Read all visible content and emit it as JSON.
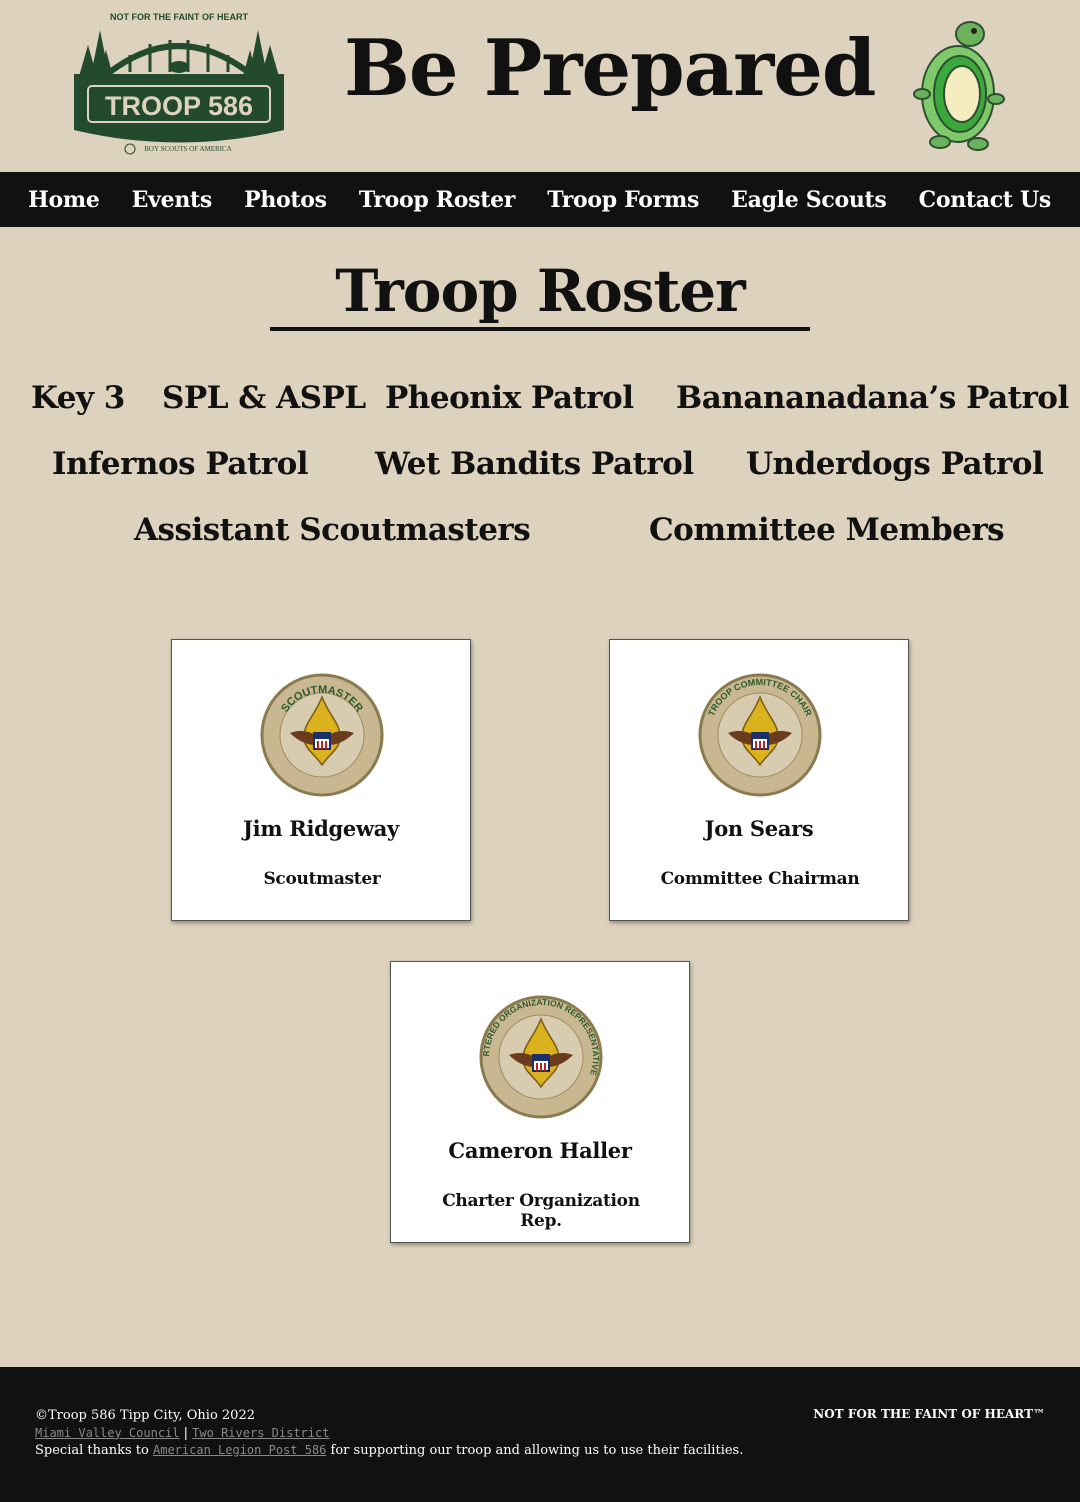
{
  "header": {
    "logo": {
      "top_text": "NOT FOR THE FAINT OF HEART",
      "name": "TROOP 586",
      "sub_text": "BOY SCOUTS OF AMERICA"
    },
    "tagline": "Be Prepared"
  },
  "nav": {
    "items": [
      "Home",
      "Events",
      "Photos",
      "Troop Roster",
      "Troop Forms",
      "Eagle Scouts",
      "Contact Us"
    ]
  },
  "page": {
    "title": "Troop Roster"
  },
  "sections": [
    "Key 3",
    "SPL & ASPL",
    "Pheonix Patrol",
    "Banananadana’s Patrol",
    "Infernos Patrol",
    "Wet Bandits Patrol",
    "Underdogs Patrol",
    "Assistant Scoutmasters",
    "Committee Members"
  ],
  "cards": [
    {
      "badge_text": "SCOUTMASTER",
      "name": "Jim Ridgeway",
      "role": "Scoutmaster"
    },
    {
      "badge_text": "TROOP COMMITTEE CHAIR",
      "name": "Jon Sears",
      "role": "Committee Chairman"
    },
    {
      "badge_text": "CHARTERED ORGANIZATION REPRESENTATIVE",
      "name": "Cameron Haller",
      "role": "Charter Organization Rep."
    }
  ],
  "footer": {
    "copyright": "©Troop 586 Tipp City, Ohio 2022",
    "council": "Miami Valley Council",
    "separator": "|",
    "district": "Two Rivers District",
    "thanks_prefix": "Special thanks to",
    "legion": "American Legion Post 586",
    "thanks_suffix": "for supporting our troop and allowing us to use their facilities.",
    "motto": "NOT FOR THE FAINT OF HEART™"
  },
  "colors": {
    "background": "#dcd2bd",
    "nav": "#111111",
    "logo_green": "#234a2c",
    "badge_tan": "#c8b790"
  }
}
